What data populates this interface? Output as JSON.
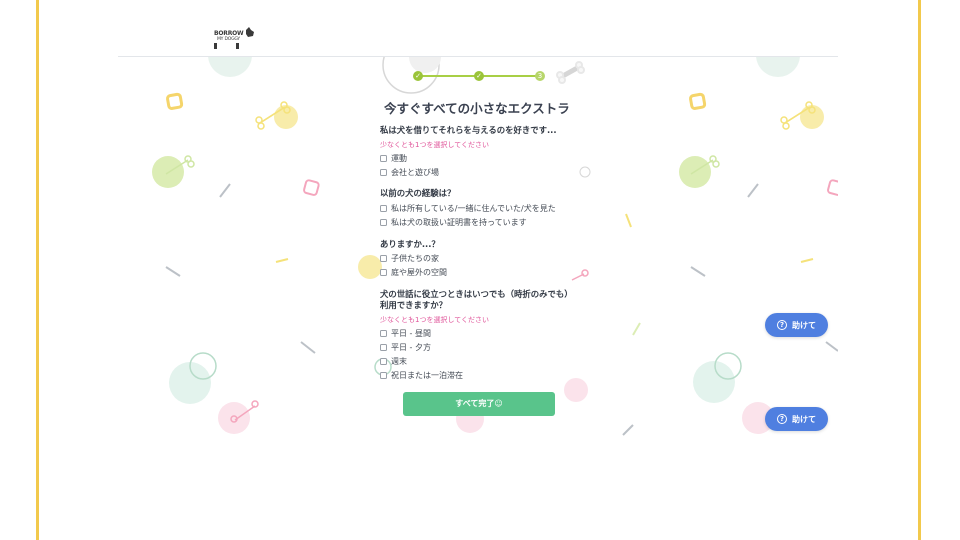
{
  "brand": {
    "logo_line1": "BORROW",
    "logo_line2": "MY DOGGY"
  },
  "stepper": {
    "steps": [
      "✓",
      "✓",
      "3"
    ]
  },
  "form": {
    "title": "今すぐすべての小さなエクストラ",
    "q1": {
      "label": "私は犬を借りてそれらを与えるのを好きです...",
      "hint": "少なくとも1つを選択してください",
      "options": [
        "運動",
        "会社と遊び場"
      ]
    },
    "q2": {
      "label": "以前の犬の経験は？",
      "options": [
        "私は所有している/一緒に住んでいた/犬を見た",
        "私は犬の取扱い証明書を持っています"
      ]
    },
    "q3": {
      "label": "ありますか...？",
      "options": [
        "子供たちの家",
        "庭や屋外の空間"
      ]
    },
    "q4": {
      "label_line1": "犬の世話に役立つときはいつでも（時折のみでも）",
      "label_line2": "利用できますか？",
      "hint": "少なくとも1つを選択してください",
      "options": [
        "平日 - 昼間",
        "平日 - 夕方",
        "週末",
        "祝日または一泊滞在"
      ]
    },
    "submit_label": "すべて完了☺"
  },
  "help": {
    "label": "助けて",
    "icon": "?"
  },
  "colors": {
    "accent_green": "#59c48b",
    "help_blue": "#4f7fe0",
    "hint_pink": "#e0559a",
    "frame_yellow": "#f2c94c",
    "stepper_green": "#9bc43a"
  }
}
